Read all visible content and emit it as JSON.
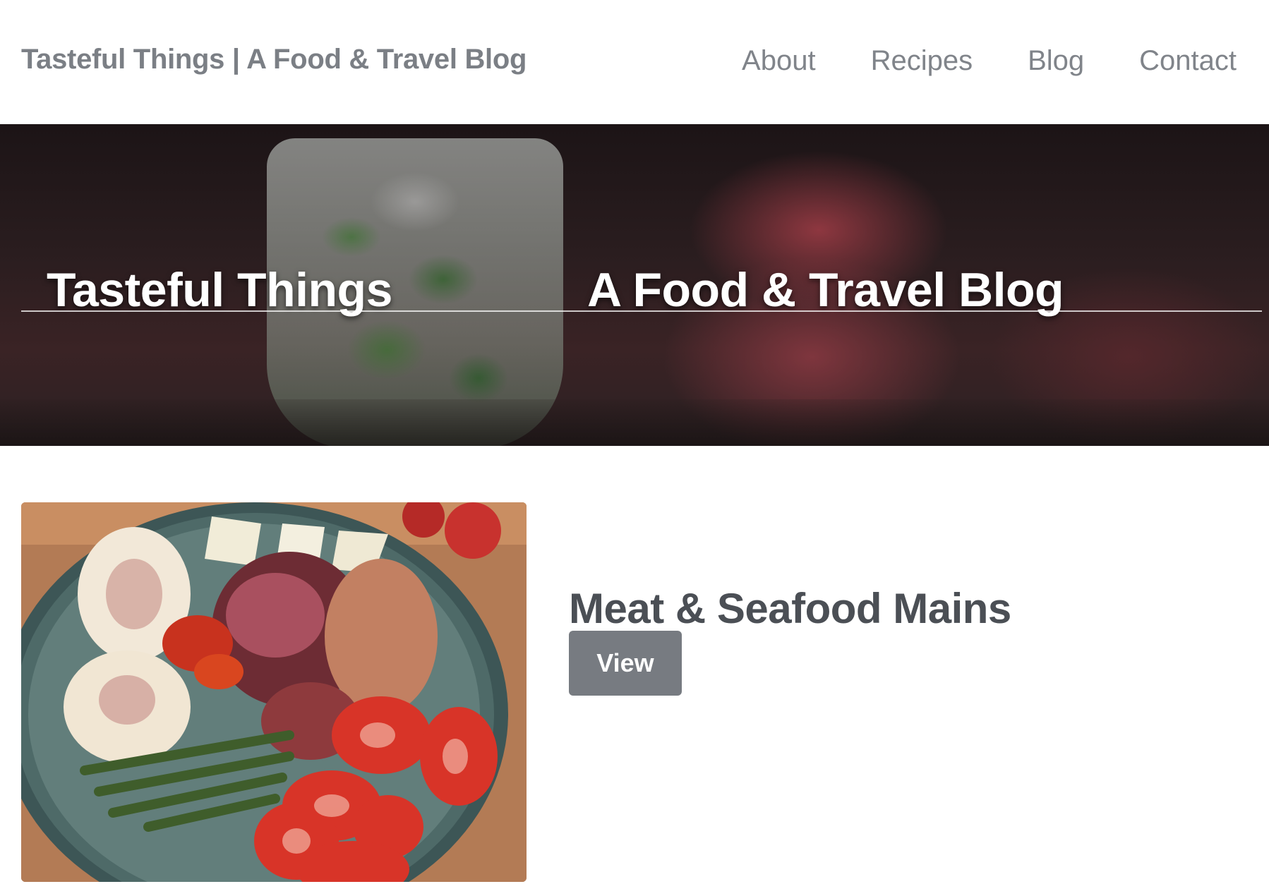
{
  "navbar": {
    "brand": "Tasteful Things | A Food & Travel Blog",
    "links": [
      {
        "label": "About"
      },
      {
        "label": "Recipes"
      },
      {
        "label": "Blog"
      },
      {
        "label": "Contact"
      }
    ]
  },
  "hero": {
    "title_left": "Tasteful Things",
    "title_right": "A Food & Travel Blog"
  },
  "card": {
    "title": "Meat & Seafood Mains",
    "button_label": "View"
  },
  "colors": {
    "brand_text": "#7b7f85",
    "nav_text": "#80848a",
    "card_title": "#4b4f55",
    "button_bg": "#777b81",
    "button_text": "#ffffff"
  }
}
